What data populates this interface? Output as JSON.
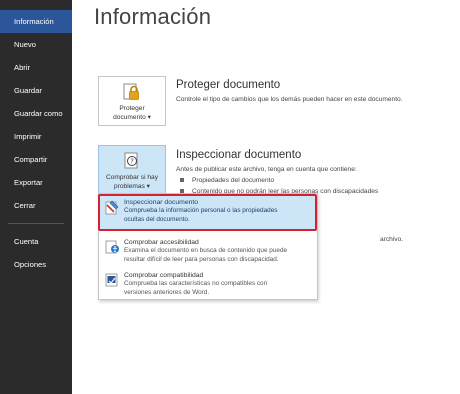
{
  "sidebar": {
    "items": [
      {
        "label": "Información",
        "active": true
      },
      {
        "label": "Nuevo"
      },
      {
        "label": "Abrir"
      },
      {
        "label": "Guardar"
      },
      {
        "label": "Guardar como"
      },
      {
        "label": "Imprimir"
      },
      {
        "label": "Compartir"
      },
      {
        "label": "Exportar"
      },
      {
        "label": "Cerrar"
      }
    ],
    "bottom_items": [
      {
        "label": "Cuenta"
      },
      {
        "label": "Opciones"
      }
    ]
  },
  "main": {
    "title": "Información",
    "protect": {
      "tile_line1": "Proteger",
      "tile_line2": "documento ▾",
      "title": "Proteger documento",
      "description": "Controle el tipo de cambios que los demás pueden hacer en este documento."
    },
    "inspect": {
      "tile_line1": "Comprobar si hay",
      "tile_line2": "problemas ▾",
      "title": "Inspeccionar documento",
      "description": "Antes de publicar este archivo, tenga en cuenta que contiene:",
      "bullets": [
        "Propiedades del documento",
        "Contenido que no podrán leer las personas con discapacidades"
      ]
    },
    "background_fragment": "archivo.",
    "dropdown": {
      "items": [
        {
          "title": "Inspeccionar documento",
          "desc_line1": "Comprueba la información personal o las propiedades",
          "desc_line2": "ocultas del documento."
        },
        {
          "title": "Comprobar accesibilidad",
          "desc_line1": "Examina el documento en busca de contenido que puede",
          "desc_line2": "resultar difícil de leer para personas con discapacidad."
        },
        {
          "title": "Comprobar compatibilidad",
          "desc_line1": "Comprueba las características no compatibles con",
          "desc_line2": "versiones anteriores de Word."
        }
      ]
    }
  },
  "colors": {
    "sidebar_bg": "#2b2b2b",
    "active_nav": "#2b579a",
    "highlight": "#cde6f7",
    "annotation_red": "#d62030"
  }
}
